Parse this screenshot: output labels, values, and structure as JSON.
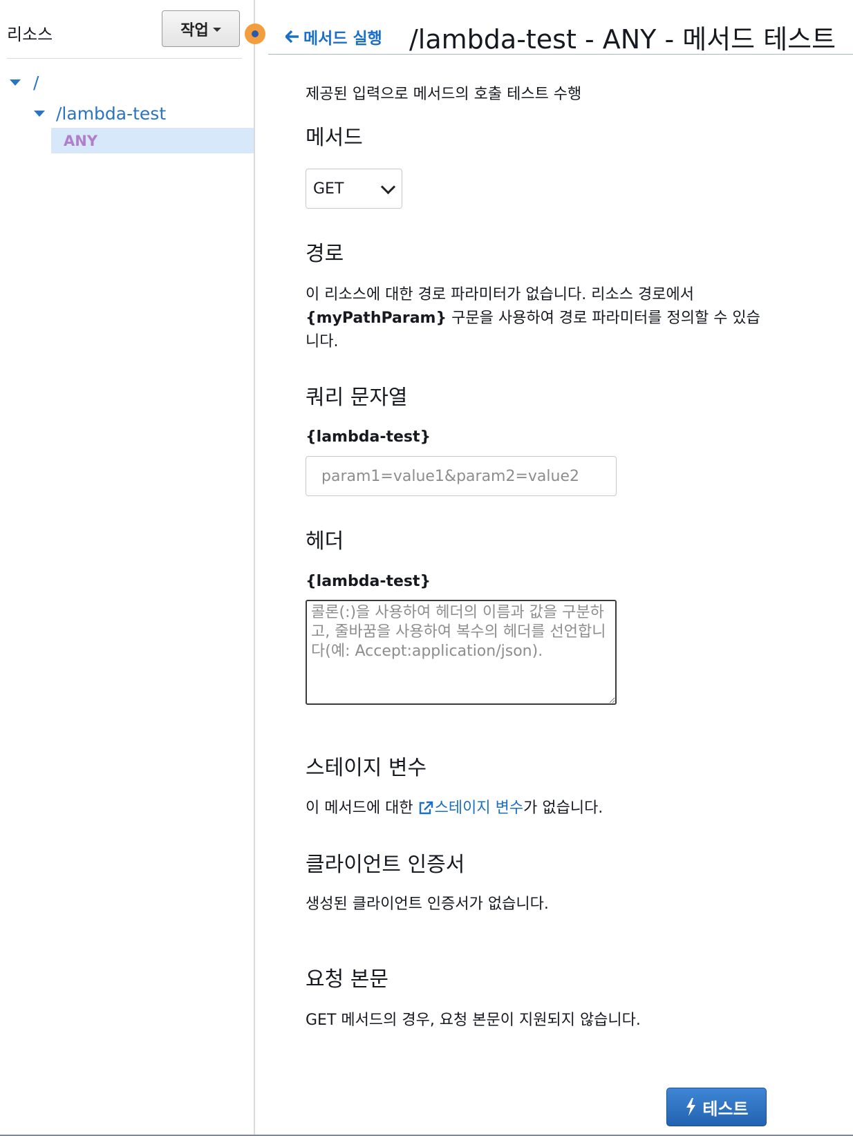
{
  "sidebar": {
    "title": "리소스",
    "actions_label": "작업",
    "tree": {
      "root": "/",
      "child": "/lambda-test",
      "method": "ANY"
    }
  },
  "header": {
    "back_label": "메서드 실행",
    "title": "/lambda-test - ANY - 메서드 테스트"
  },
  "main": {
    "intro": "제공된 입력으로 메서드의 호출 테스트 수행",
    "method": {
      "heading": "메서드",
      "selected": "GET"
    },
    "path": {
      "heading": "경로",
      "desc_prefix": "이 리소스에 대한 경로 파라미터가 없습니다. 리소스 경로에서",
      "desc_param": "{myPathParam}",
      "desc_suffix": "구문을 사용하여 경로 파라미터를 정의할 수 있습니다."
    },
    "query": {
      "heading": "쿼리 문자열",
      "label": "{lambda-test}",
      "placeholder": "param1=value1&param2=value2"
    },
    "headers": {
      "heading": "헤더",
      "label": "{lambda-test}",
      "placeholder": "콜론(:)을 사용하여 헤더의 이름과 값을 구분하고, 줄바꿈을 사용하여 복수의 헤더를 선언합니다(예: Accept:application/json)."
    },
    "stage_vars": {
      "heading": "스테이지 변수",
      "desc_prefix": "이 메서드에 대한",
      "link": "스테이지 변수",
      "desc_suffix": "가 없습니다."
    },
    "client_cert": {
      "heading": "클라이언트 인증서",
      "desc": "생성된 클라이언트 인증서가 없습니다."
    },
    "body": {
      "heading": "요청 본문",
      "desc": "GET 메서드의 경우, 요청 본문이 지원되지 않습니다."
    },
    "test_button": "테스트"
  }
}
